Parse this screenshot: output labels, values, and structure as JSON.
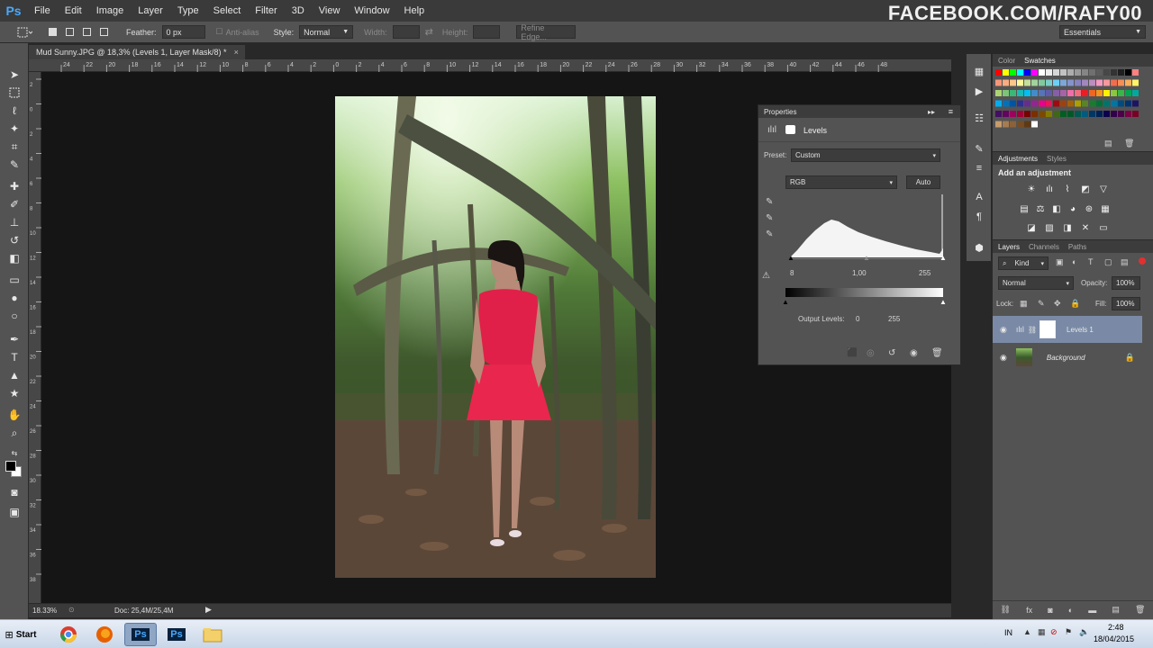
{
  "app": {
    "logo": "Ps",
    "menu": [
      "File",
      "Edit",
      "Image",
      "Layer",
      "Type",
      "Select",
      "Filter",
      "3D",
      "View",
      "Window",
      "Help"
    ],
    "watermark": "FACEBOOK.COM/RAFY00"
  },
  "options_bar": {
    "feather_label": "Feather:",
    "feather_value": "0 px",
    "antialias_label": "Anti-alias",
    "style_label": "Style:",
    "style_value": "Normal",
    "width_label": "Width:",
    "height_label": "Height:",
    "refine_label": "Refine Edge...",
    "workspace": "Essentials"
  },
  "document": {
    "tab_title": "Mud Sunny.JPG @ 18,3% (Levels 1, Layer Mask/8) *",
    "close": "×",
    "zoom": "18.33%",
    "doc_info": "Doc: 25,4M/25,4M",
    "ruler_labels": [
      "24",
      "22",
      "20",
      "18",
      "16",
      "14",
      "12",
      "10",
      "8",
      "6",
      "4",
      "2",
      "0",
      "2",
      "4",
      "6",
      "8",
      "10",
      "12",
      "14",
      "16",
      "18",
      "20",
      "22",
      "24",
      "26",
      "28",
      "30",
      "32",
      "34",
      "36",
      "38",
      "40",
      "42",
      "44",
      "46",
      "48"
    ],
    "vruler_labels": [
      "2",
      "0",
      "2",
      "4",
      "6",
      "8",
      "10",
      "12",
      "14",
      "16",
      "18",
      "20",
      "22",
      "24",
      "26",
      "28",
      "30",
      "32",
      "34",
      "36",
      "38"
    ]
  },
  "properties": {
    "title": "Properties",
    "section": "Levels",
    "preset_label": "Preset:",
    "preset_value": "Custom",
    "channel": "RGB",
    "auto": "Auto",
    "input_black": "8",
    "input_mid": "1,00",
    "input_white": "255",
    "output_label": "Output Levels:",
    "output_black": "0",
    "output_white": "255"
  },
  "swatches_panel": {
    "tab_color": "Color",
    "tab_swatches": "Swatches"
  },
  "adjustments_panel": {
    "tab_adjustments": "Adjustments",
    "tab_styles": "Styles",
    "add_label": "Add an adjustment"
  },
  "layers_panel": {
    "tab_layers": "Layers",
    "tab_channels": "Channels",
    "tab_paths": "Paths",
    "kind": "Kind",
    "blend_mode": "Normal",
    "opacity_label": "Opacity:",
    "opacity_value": "100%",
    "lock_label": "Lock:",
    "fill_label": "Fill:",
    "fill_value": "100%",
    "layers": [
      {
        "name": "Levels 1",
        "selected": true
      },
      {
        "name": "Background",
        "selected": false
      }
    ]
  },
  "taskbar": {
    "start": "Start",
    "lang": "IN",
    "time": "2:48",
    "date": "18/04/2015"
  }
}
